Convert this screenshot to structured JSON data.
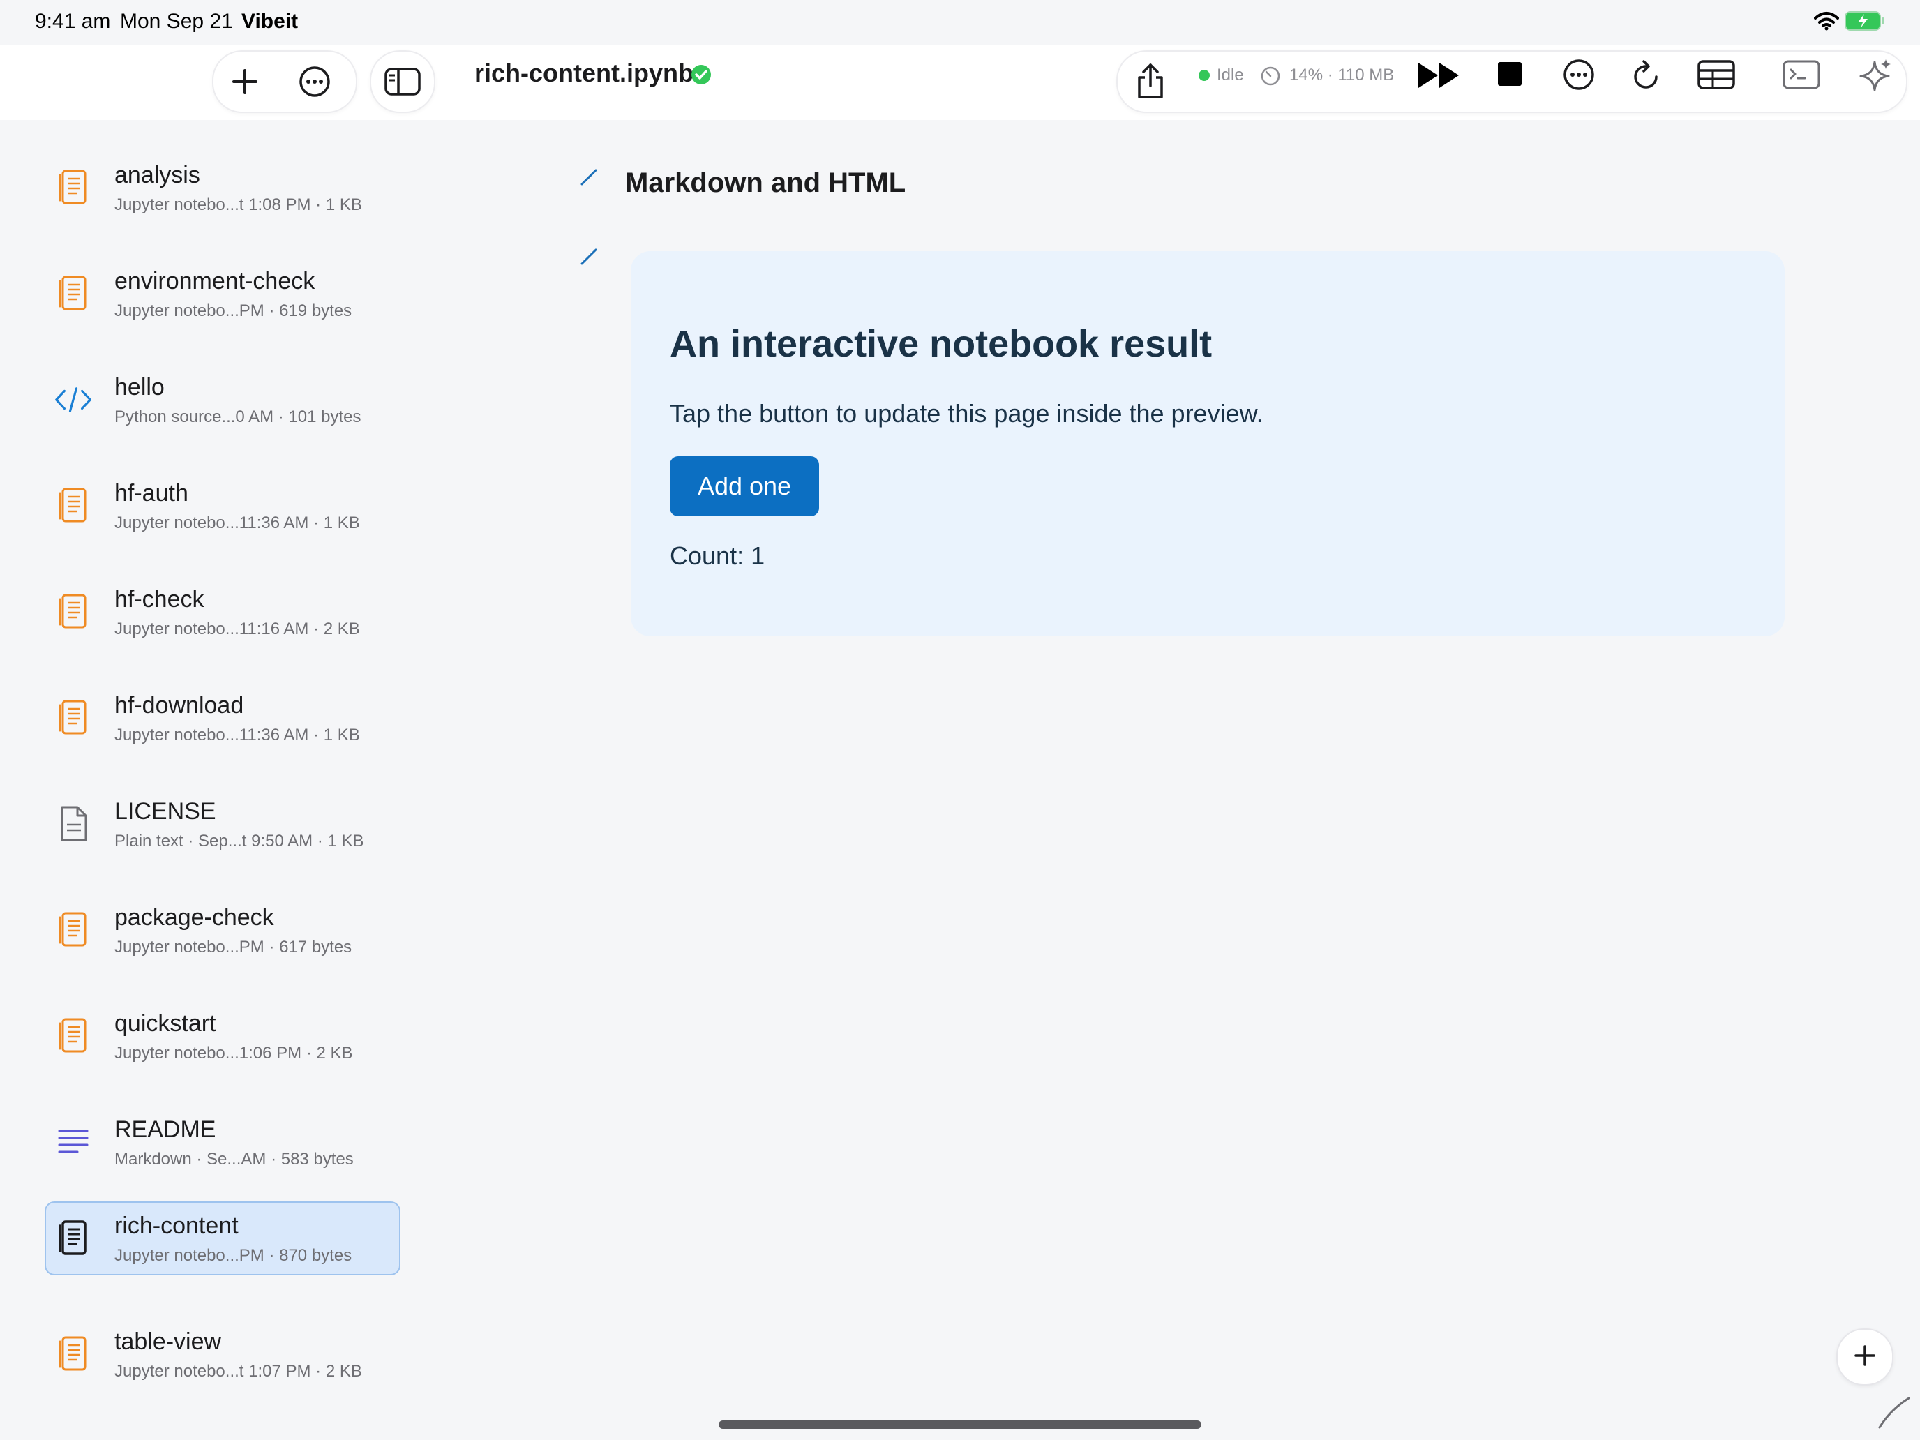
{
  "status_bar": {
    "time": "9:41 am",
    "date": "Mon Sep 21",
    "app": "Vibeit"
  },
  "toolbar": {
    "add_icon": "plus-icon",
    "more_icon": "ellipsis-circle-icon",
    "sidebar_icon": "sidebar-toggle-icon",
    "document_title": "rich-content.ipynb",
    "saved_icon": "checkmark-circle-icon",
    "kernel_status": "Idle",
    "kernel_usage": "14% · 110 MB",
    "accent": "#34c759"
  },
  "sidebar": {
    "items": [
      {
        "name": "analysis",
        "meta": "Jupyter notebo...t 1:08 PM · 1 KB",
        "icon": "notebook-icon"
      },
      {
        "name": "environment-check",
        "meta": "Jupyter notebo...PM · 619 bytes",
        "icon": "notebook-icon"
      },
      {
        "name": "hello",
        "meta": "Python source...0 AM · 101 bytes",
        "icon": "code-icon"
      },
      {
        "name": "hf-auth",
        "meta": "Jupyter notebo...11:36 AM · 1 KB",
        "icon": "notebook-icon"
      },
      {
        "name": "hf-check",
        "meta": "Jupyter notebo...11:16 AM · 2 KB",
        "icon": "notebook-icon"
      },
      {
        "name": "hf-download",
        "meta": "Jupyter notebo...11:36 AM · 1 KB",
        "icon": "notebook-icon"
      },
      {
        "name": "LICENSE",
        "meta": "Plain text · Sep...t 9:50 AM · 1 KB",
        "icon": "text-file-icon"
      },
      {
        "name": "package-check",
        "meta": "Jupyter notebo...PM · 617 bytes",
        "icon": "notebook-icon"
      },
      {
        "name": "quickstart",
        "meta": "Jupyter notebo...1:06 PM · 2 KB",
        "icon": "notebook-icon"
      },
      {
        "name": "README",
        "meta": "Markdown · Se...AM · 583 bytes",
        "icon": "markdown-icon"
      },
      {
        "name": "rich-content",
        "meta": "Jupyter notebo...PM · 870 bytes",
        "icon": "notebook-icon",
        "selected": true
      },
      {
        "name": "table-view",
        "meta": "Jupyter notebo...t 1:07 PM · 2 KB",
        "icon": "notebook-icon"
      }
    ]
  },
  "notebook": {
    "markdown_heading": "Markdown and HTML",
    "output": {
      "title": "An interactive notebook result",
      "description": "Tap the button to update this page inside the preview.",
      "button_label": "Add one",
      "count_text": "Count: 1"
    }
  },
  "colors": {
    "notebook_icon": "#ef8b24",
    "code_icon": "#1a7fd4",
    "markdown_icon": "#5b57d6",
    "button": "#0c6fc2",
    "card": "#eaf3fd"
  }
}
